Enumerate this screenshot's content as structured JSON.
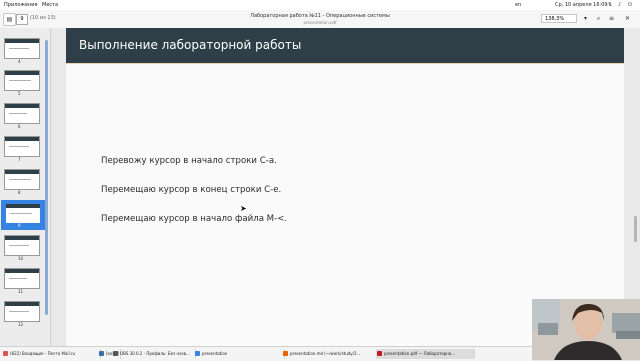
{
  "topbar": {
    "apps": "Приложения",
    "places": "Места",
    "lang": "en",
    "datetime": "Ср, 10 апреля 16:09"
  },
  "header": {
    "page_current": "9",
    "page_count": "(10 из 13)",
    "title": "Лабораторная работа №11 - Операционные системы",
    "subtitle": "presentation.pdf",
    "zoom": "138,3%"
  },
  "thumbnails": [
    "4",
    "5",
    "6",
    "7",
    "8",
    "9",
    "10",
    "11",
    "12"
  ],
  "slide": {
    "title": "Выполнение лабораторной работы",
    "lines": [
      "Перевожу курсор в начало строки C-a.",
      "Перемещаю курсор в конец строки C-e.",
      "Перемещаю курсор в начало файла M-<."
    ]
  },
  "taskbar": {
    "items": [
      "(822) Входящие - Почта Mail.ru",
      "[eol...]",
      "OBS 30.0.2 - Профиль: Без назв...",
      "presentation",
      "presentation.md (~/work/study/2...",
      "presentation.pdf — Лабораторна..."
    ],
    "colors": [
      "#d9534f",
      "#3a6ea5",
      "#555555",
      "#3584e4",
      "#e66100",
      "#c01c28"
    ]
  },
  "colors": {
    "slide_header": "#2f3f47",
    "selection": "#3584e4"
  }
}
